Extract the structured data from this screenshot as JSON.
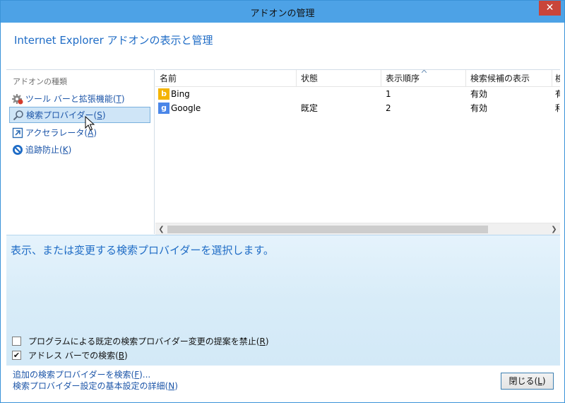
{
  "window": {
    "title": "アドオンの管理",
    "close_glyph": "✕"
  },
  "header": {
    "text": "Internet Explorer アドオンの表示と管理"
  },
  "sidebar": {
    "group_label": "アドオンの種類",
    "items": [
      {
        "label": "ツール バーと拡張機能(",
        "key": "T",
        "tail": ")",
        "icon": "gear-icon",
        "selected": false
      },
      {
        "label": "検索プロバイダー(",
        "key": "S",
        "tail": ")",
        "icon": "search-icon",
        "selected": true
      },
      {
        "label": "アクセラレータ(",
        "key": "A",
        "tail": ")",
        "icon": "accelerator-icon",
        "selected": false
      },
      {
        "label": "追跡防止(",
        "key": "K",
        "tail": ")",
        "icon": "tracking-protection-icon",
        "selected": false
      }
    ]
  },
  "table": {
    "columns": [
      "名前",
      "状態",
      "表示順序",
      "検索候補の表示",
      "検"
    ],
    "sorted_column": "表示順序",
    "rows": [
      {
        "icon": "bing-icon",
        "name": "Bing",
        "status": "",
        "order": "1",
        "suggest": "有効",
        "more": "有"
      },
      {
        "icon": "google-icon",
        "name": "Google",
        "status": "既定",
        "order": "2",
        "suggest": "有効",
        "more": "利"
      }
    ]
  },
  "detail": {
    "message": "表示、または変更する検索プロバイダーを選択します。",
    "checkboxes": [
      {
        "label": "プログラムによる既定の検索プロバイダー変更の提案を禁止(",
        "key": "R",
        "tail": ")",
        "checked": false,
        "mark": ""
      },
      {
        "label": "アドレス バーでの検索(",
        "key": "B",
        "tail": ")",
        "checked": true,
        "mark": "✔"
      }
    ]
  },
  "footer": {
    "links": [
      {
        "label": "追加の検索プロバイダーを検索(",
        "key": "F",
        "tail": ")..."
      },
      {
        "label": "検索プロバイダー設定の基本設定の詳細(",
        "key": "N",
        "tail": ")"
      }
    ],
    "close_button": {
      "label": "閉じる(",
      "key": "L",
      "tail": ")"
    }
  },
  "colors": {
    "titlebar": "#4da2e6",
    "accent_text": "#1f6cc6",
    "link": "#1c55a8",
    "close_button": "#c9453a",
    "selection": "#cfe5f7",
    "bing_brand": "#f4b400",
    "google_brand": "#4a86e8"
  }
}
